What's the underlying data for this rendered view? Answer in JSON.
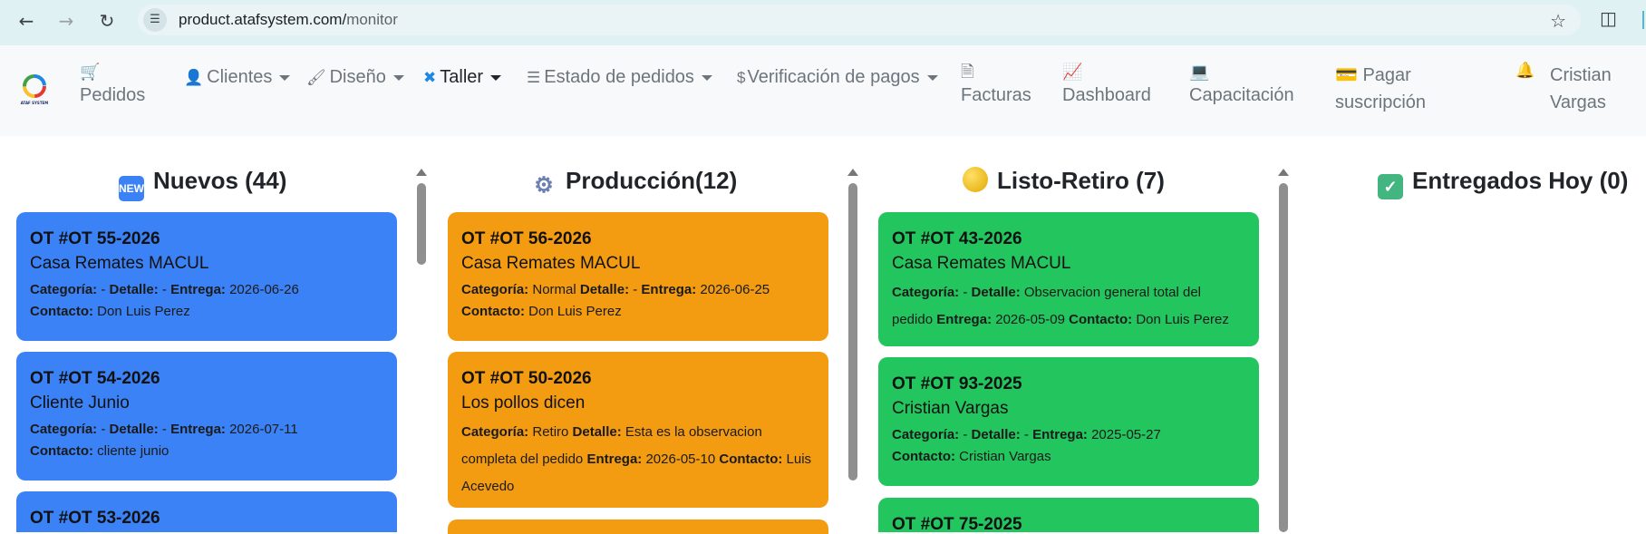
{
  "browser": {
    "url_host": "product.atafsystem.com/",
    "url_path": "monitor"
  },
  "navbar": {
    "logo_text": "ATAF SYSTEM",
    "pedidos": "Pedidos",
    "clientes": "Clientes",
    "diseno": "Diseño",
    "taller": "Taller",
    "estado": "Estado de pedidos",
    "verificacion": "Verificación de pagos",
    "facturas": "Facturas",
    "dashboard": "Dashboard",
    "capacitacion": "Capacitación",
    "pagar_1": "Pagar",
    "pagar_2": "suscripción",
    "user_1": "Cristian",
    "user_2": "Vargas"
  },
  "colors": {
    "nuevos": "#3b82f6",
    "produccion": "#f39c12",
    "listo": "#22c55e"
  },
  "labels": {
    "categoria": "Categoría:",
    "detalle": "Detalle:",
    "entrega": "Entrega:",
    "contacto": "Contacto:"
  },
  "columns": {
    "nuevos": {
      "title": "Nuevos (44)",
      "icon_text": "NEW",
      "cards": [
        {
          "ot": "OT #OT 55-2026",
          "client": "Casa Remates MACUL",
          "categoria": "-",
          "detalle": "-",
          "entrega": "2026-06-26",
          "contacto": "Don Luis Perez"
        },
        {
          "ot": "OT #OT 54-2026",
          "client": "Cliente Junio",
          "categoria": "-",
          "detalle": "-",
          "entrega": "2026-07-11",
          "contacto": "cliente junio"
        },
        {
          "ot": "OT #OT 53-2026"
        }
      ]
    },
    "produccion": {
      "title": "Producción(12)",
      "cards": [
        {
          "ot": "OT #OT 56-2026",
          "client": "Casa Remates MACUL",
          "categoria": "Normal",
          "detalle": "-",
          "entrega": "2026-06-25",
          "contacto": "Don Luis Perez"
        },
        {
          "ot": "OT #OT 50-2026",
          "client": "Los pollos dicen",
          "categoria": "Retiro",
          "detalle": "Esta es la observacion completa del pedido",
          "entrega": "2026-05-10",
          "contacto": "Luis Acevedo"
        }
      ]
    },
    "listo": {
      "title": "Listo-Retiro (7)",
      "cards": [
        {
          "ot": "OT #OT 43-2026",
          "client": "Casa Remates MACUL",
          "categoria": "-",
          "detalle": "Observacion general total del pedido",
          "entrega": "2026-05-09",
          "contacto": "Don Luis Perez"
        },
        {
          "ot": "OT #OT 93-2025",
          "client": "Cristian Vargas",
          "categoria": "-",
          "detalle": "-",
          "entrega": "2025-05-27",
          "contacto": "Cristian Vargas"
        },
        {
          "ot": "OT #OT 75-2025"
        }
      ]
    },
    "entregados": {
      "title": "Entregados Hoy (0)"
    }
  }
}
